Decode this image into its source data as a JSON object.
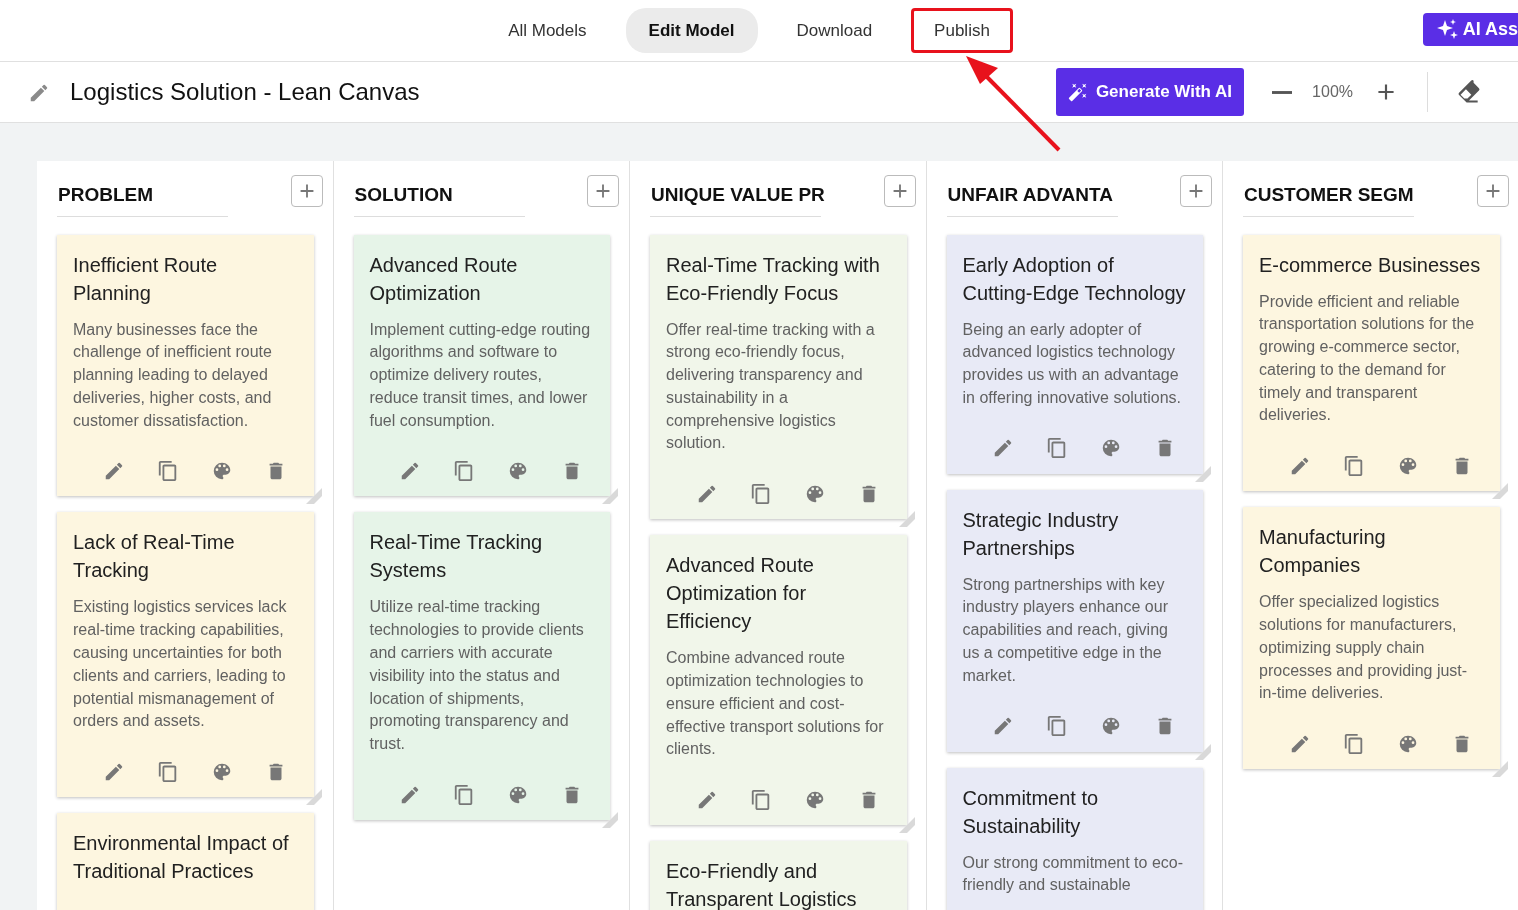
{
  "top_nav": {
    "tabs": [
      {
        "label": "All Models",
        "selected": false,
        "highlighted": false
      },
      {
        "label": "Edit Model",
        "selected": true,
        "highlighted": false
      },
      {
        "label": "Download",
        "selected": false,
        "highlighted": false
      },
      {
        "label": "Publish",
        "selected": false,
        "highlighted": true
      }
    ],
    "ai_button": "AI Ass"
  },
  "toolbar": {
    "title": "Logistics Solution - Lean Canvas",
    "generate_button": "Generate With AI",
    "zoom": "100%"
  },
  "columns": [
    {
      "title": "PROBLEM",
      "cards": [
        {
          "title": "Inefficient Route Planning",
          "body": "Many businesses face the challenge of inefficient route planning leading to delayed deliveries, higher costs, and customer dissatisfaction.",
          "color": "#fdf6e0",
          "actions_visible": true
        },
        {
          "title": "Lack of Real-Time Tracking",
          "body": "Existing logistics services lack real-time tracking capabilities, causing uncertainties for both clients and carriers, leading to potential mismanagement of orders and assets.",
          "color": "#fdf6e0",
          "actions_visible": true
        },
        {
          "title": "Environmental Impact of Traditional Practices",
          "color": "#fdf6e0",
          "actions_visible": false
        }
      ]
    },
    {
      "title": "SOLUTION",
      "cards": [
        {
          "title": "Advanced Route Optimization",
          "body": "Implement cutting-edge routing algorithms and software to optimize delivery routes, reduce transit times, and lower fuel consumption.",
          "color": "#e6f4e8",
          "actions_visible": true
        },
        {
          "title": "Real-Time Tracking Systems",
          "body": "Utilize real-time tracking technologies to provide clients and carriers with accurate visibility into the status and location of shipments, promoting transparency and trust.",
          "color": "#e6f4e8",
          "actions_visible": true
        }
      ]
    },
    {
      "title": "UNIQUE VALUE PR",
      "cards": [
        {
          "title": "Real-Time Tracking with Eco-Friendly Focus",
          "body": "Offer real-time tracking with a strong eco-friendly focus, delivering transparency and sustainability in a comprehensive logistics solution.",
          "color": "#f1f6ea",
          "actions_visible": true
        },
        {
          "title": "Advanced Route Optimization for Efficiency",
          "body": "Combine advanced route optimization technologies to ensure efficient and cost-effective transport solutions for clients.",
          "color": "#f1f6ea",
          "actions_visible": true
        },
        {
          "title": "Eco-Friendly and Transparent Logistics",
          "color": "#f1f6ea",
          "actions_visible": false
        }
      ]
    },
    {
      "title": "UNFAIR ADVANTA",
      "cards": [
        {
          "title": "Early Adoption of Cutting-Edge Technology",
          "body": "Being an early adopter of advanced logistics technology provides us with an advantage in offering innovative solutions.",
          "color": "#e8eaf6",
          "actions_visible": true
        },
        {
          "title": "Strategic Industry Partnerships",
          "body": "Strong partnerships with key industry players enhance our capabilities and reach, giving us a competitive edge in the market.",
          "color": "#e8eaf6",
          "actions_visible": true
        },
        {
          "title": "Commitment to Sustainability",
          "body": "Our strong commitment to eco-friendly and sustainable",
          "color": "#e8eaf6",
          "actions_visible": false
        }
      ]
    },
    {
      "title": "CUSTOMER SEGM",
      "cards": [
        {
          "title": "E-commerce Businesses",
          "body": "Provide efficient and reliable transportation solutions for the growing e-commerce sector, catering to the demand for timely and transparent deliveries.",
          "color": "#fdf6e0",
          "actions_visible": true
        },
        {
          "title": "Manufacturing Companies",
          "body": "Offer specialized logistics solutions for manufacturers, optimizing supply chain processes and providing just-in-time deliveries.",
          "color": "#fdf6e0",
          "actions_visible": true
        }
      ]
    }
  ]
}
